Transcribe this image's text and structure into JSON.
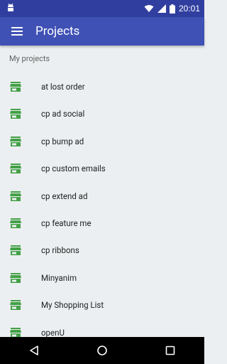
{
  "status_bar": {
    "time": "20:01",
    "left_icon": "android-icon",
    "wifi_icon": "wifi-icon",
    "signal_icon": "signal-icon",
    "battery_icon": "battery-icon"
  },
  "app_bar": {
    "title": "Projects",
    "menu_icon": "menu-icon"
  },
  "section": {
    "label": "My projects"
  },
  "projects": [
    {
      "name": "at lost order",
      "icon": "store-icon"
    },
    {
      "name": "cp ad social",
      "icon": "store-icon"
    },
    {
      "name": "cp bump ad",
      "icon": "store-icon"
    },
    {
      "name": "cp custom emails",
      "icon": "store-icon"
    },
    {
      "name": "cp extend ad",
      "icon": "store-icon"
    },
    {
      "name": "cp feature me",
      "icon": "store-icon"
    },
    {
      "name": "cp ribbons",
      "icon": "store-icon"
    },
    {
      "name": "Minyanim",
      "icon": "store-icon"
    },
    {
      "name": "My Shopping List",
      "icon": "store-icon"
    },
    {
      "name": "openU",
      "icon": "store-icon"
    }
  ],
  "nav_bar": {
    "back_icon": "back-icon",
    "home_icon": "home-icon",
    "recents_icon": "recents-icon"
  },
  "colors": {
    "status_bar": "#303f9f",
    "app_bar": "#3f51b5",
    "background": "#eceff1",
    "store_icon": "#43a047"
  }
}
